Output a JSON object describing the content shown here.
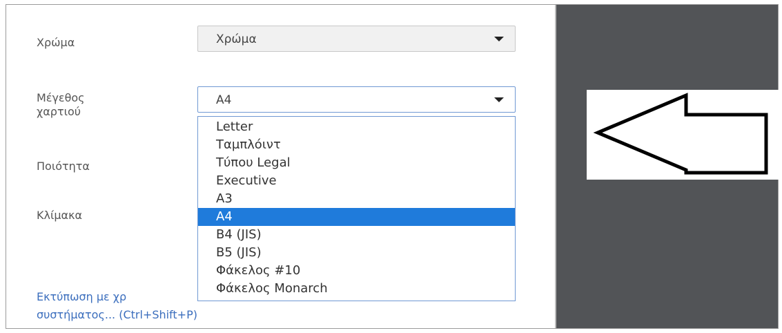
{
  "settings": {
    "color_label": "Χρώμα",
    "color_value": "Χρώμα",
    "paper_size_label": "Μέγεθος χαρτιού",
    "paper_size_value": "A4",
    "quality_label": "Ποιότητα",
    "scale_label": "Κλίμακα"
  },
  "paper_size_options": [
    "Letter",
    "Ταμπλόιντ",
    "Τύπου Legal",
    "Executive",
    "A3",
    "A4",
    "B4 (JIS)",
    "B5 (JIS)",
    "Φάκελος #10",
    "Φάκελος Monarch"
  ],
  "selected_option_index": 5,
  "system_dialog": {
    "line1": "Εκτύπωση με χρ",
    "line2": "συστήματος... (Ctrl+Shift+P)"
  },
  "colors": {
    "preview_background": "#525457",
    "selection": "#1f7bdb",
    "link": "#3b6ebd"
  },
  "icons": [
    "chevron-down-icon",
    "left-arrow-icon"
  ]
}
